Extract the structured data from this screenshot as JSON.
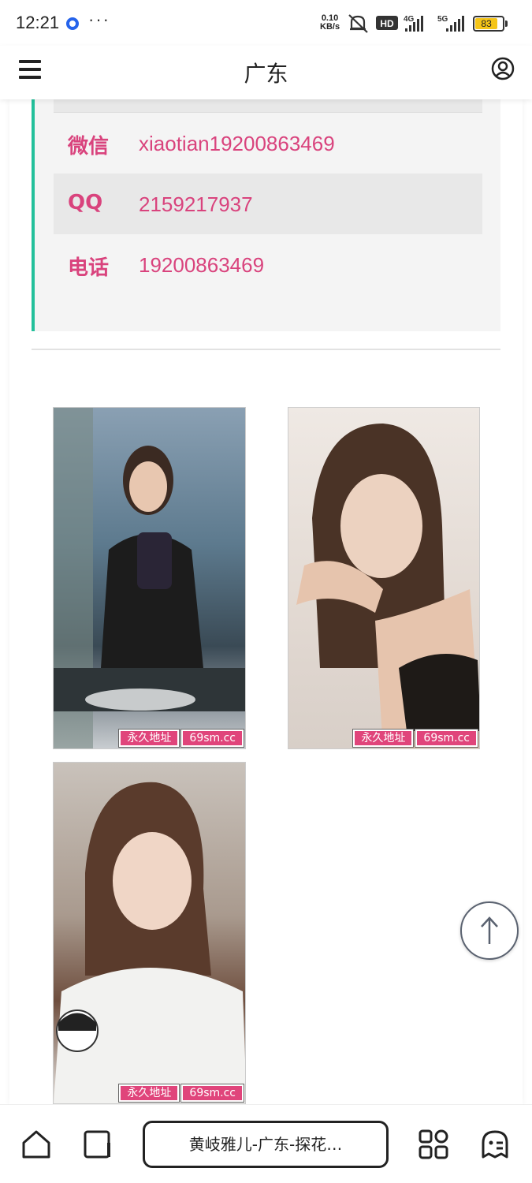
{
  "status_bar": {
    "time": "12:21",
    "more": "···",
    "speed_value": "0.10",
    "speed_unit": "KB/s",
    "battery": "83",
    "network_4g": "4G",
    "network_5g": "5G",
    "hd_label": "HD"
  },
  "header": {
    "title": "广东",
    "menu_icon": "hamburger-menu-icon",
    "user_icon": "user-circle-icon"
  },
  "contact": {
    "rows": [
      {
        "label": "微信",
        "value": "xiaotian19200863469"
      },
      {
        "label": "QQ",
        "value": "2159217937"
      },
      {
        "label": "电话",
        "value": "19200863469"
      }
    ],
    "accent_color": "#23c09b",
    "text_color": "#d9437d"
  },
  "photos": [
    {
      "watermark_left": "永久地址",
      "watermark_right": "69sm.cc"
    },
    {
      "watermark_left": "永久地址",
      "watermark_right": "69sm.cc"
    },
    {
      "watermark_left": "永久地址",
      "watermark_right": "69sm.cc"
    }
  ],
  "back_to_top_icon": "arrow-up-icon",
  "bottom_bar": {
    "url_text": "黄岐雅儿-广东-探花…",
    "icons": [
      "home-icon",
      "tabs-icon",
      "apps-icon",
      "ghost-icon"
    ]
  }
}
